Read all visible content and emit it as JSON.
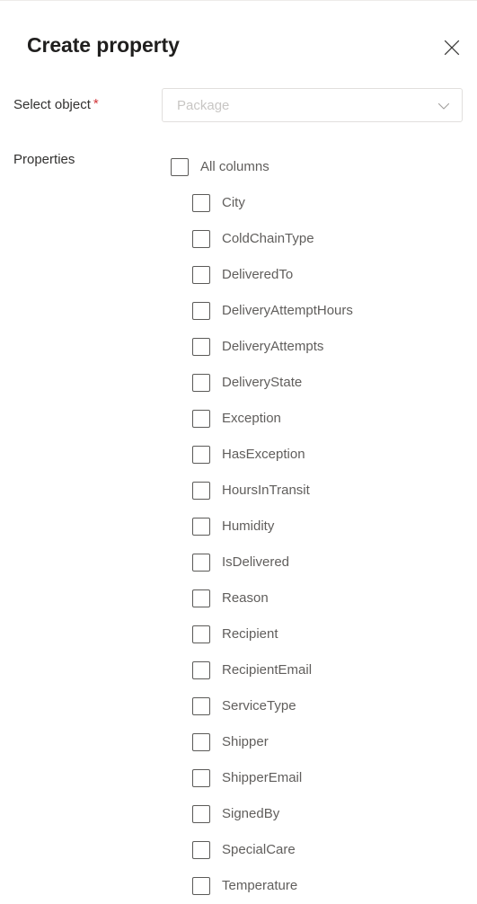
{
  "panel": {
    "title": "Create property",
    "close_icon": "close-icon"
  },
  "form": {
    "select_object": {
      "label": "Select object",
      "required_marker": "*",
      "dropdown_placeholder": "Package",
      "dropdown_value": "",
      "chevron_icon": "chevron-down-icon"
    },
    "properties": {
      "label": "Properties",
      "select_all": {
        "label": "All columns",
        "checked": false
      },
      "items": [
        {
          "label": "City",
          "checked": false
        },
        {
          "label": "ColdChainType",
          "checked": false
        },
        {
          "label": "DeliveredTo",
          "checked": false
        },
        {
          "label": "DeliveryAttemptHours",
          "checked": false
        },
        {
          "label": "DeliveryAttempts",
          "checked": false
        },
        {
          "label": "DeliveryState",
          "checked": false
        },
        {
          "label": "Exception",
          "checked": false
        },
        {
          "label": "HasException",
          "checked": false
        },
        {
          "label": "HoursInTransit",
          "checked": false
        },
        {
          "label": "Humidity",
          "checked": false
        },
        {
          "label": "IsDelivered",
          "checked": false
        },
        {
          "label": "Reason",
          "checked": false
        },
        {
          "label": "Recipient",
          "checked": false
        },
        {
          "label": "RecipientEmail",
          "checked": false
        },
        {
          "label": "ServiceType",
          "checked": false
        },
        {
          "label": "Shipper",
          "checked": false
        },
        {
          "label": "ShipperEmail",
          "checked": false
        },
        {
          "label": "SignedBy",
          "checked": false
        },
        {
          "label": "SpecialCare",
          "checked": false
        },
        {
          "label": "Temperature",
          "checked": false
        }
      ]
    }
  },
  "colors": {
    "text_primary": "#201f1e",
    "text_secondary": "#323130",
    "text_muted": "#605e5c",
    "placeholder": "#c8c6c4",
    "border": "#e1dfdd",
    "checkbox_border": "#5b5a58",
    "required": "#d13438",
    "background": "#ffffff"
  }
}
